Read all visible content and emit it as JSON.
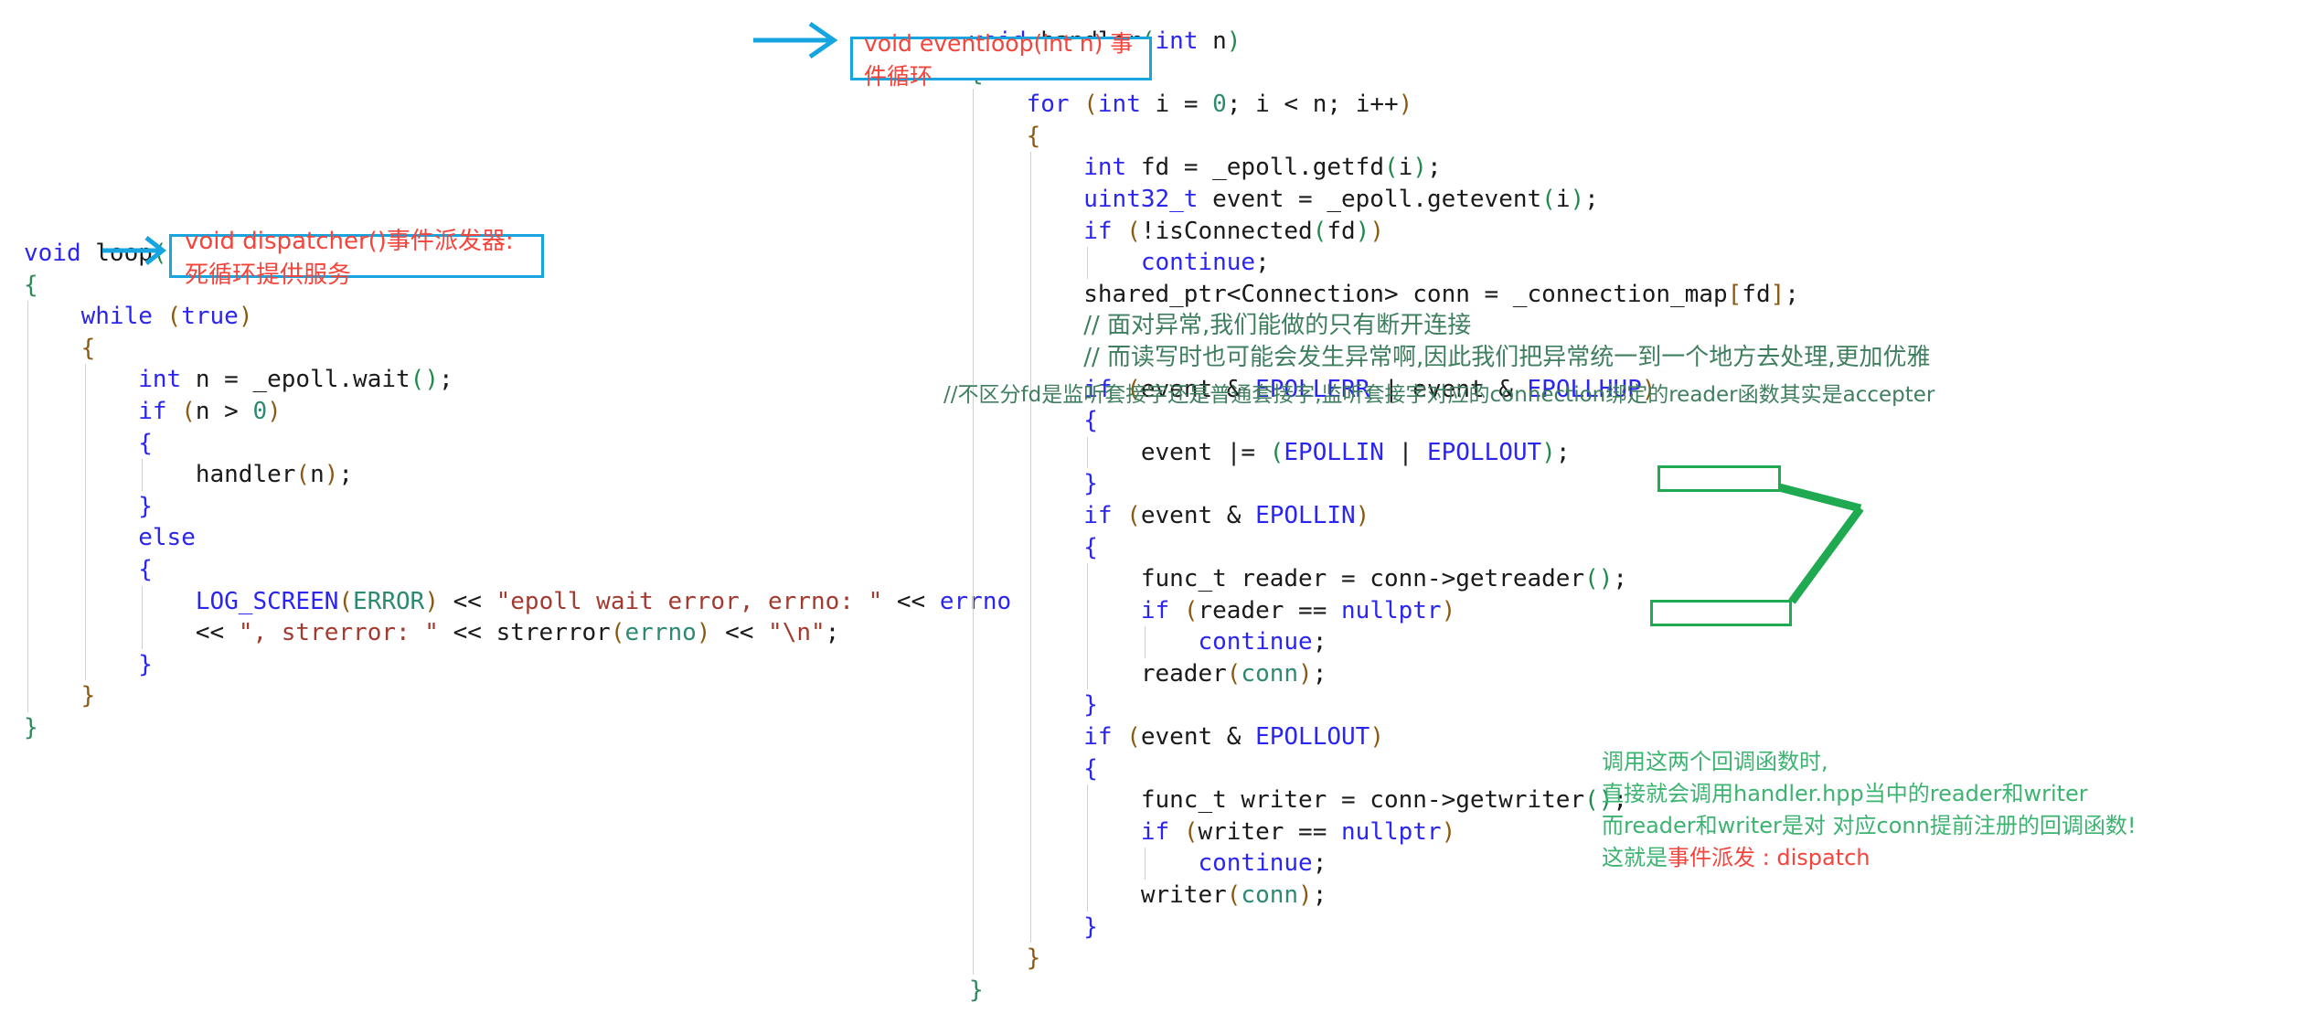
{
  "left_code": {
    "title": "void loop()",
    "lines": [
      [
        {
          "t": "void ",
          "c": "typ"
        },
        {
          "t": "loop",
          "c": "fn"
        },
        {
          "t": "()",
          "c": "par3"
        }
      ],
      [
        {
          "t": "{",
          "c": "brc-g"
        }
      ],
      [
        {
          "t": "    "
        },
        {
          "t": "while ",
          "c": "kw"
        },
        {
          "t": "(",
          "c": "par"
        },
        {
          "t": "true",
          "c": "kw"
        },
        {
          "t": ")",
          "c": "par"
        }
      ],
      [
        {
          "t": "    "
        },
        {
          "t": "{",
          "c": "brc-o"
        }
      ],
      [
        {
          "t": "        "
        },
        {
          "t": "int ",
          "c": "typ"
        },
        {
          "t": "n = _epoll.",
          "c": "pl"
        },
        {
          "t": "wait",
          "c": "fn"
        },
        {
          "t": "()",
          "c": "par3"
        },
        {
          "t": ";",
          "c": "pl"
        }
      ],
      [
        {
          "t": "        "
        },
        {
          "t": "if ",
          "c": "kw"
        },
        {
          "t": "(",
          "c": "par"
        },
        {
          "t": "n ",
          "c": "pl"
        },
        {
          "t": "> ",
          "c": "pl"
        },
        {
          "t": "0",
          "c": "num"
        },
        {
          "t": ")",
          "c": "par"
        }
      ],
      [
        {
          "t": "        "
        },
        {
          "t": "{",
          "c": "brc-b"
        }
      ],
      [
        {
          "t": "            "
        },
        {
          "t": "handler",
          "c": "pl"
        },
        {
          "t": "(",
          "c": "par"
        },
        {
          "t": "n",
          "c": "pl"
        },
        {
          "t": ")",
          "c": "par"
        },
        {
          "t": ";",
          "c": "pl"
        }
      ],
      [
        {
          "t": "        "
        },
        {
          "t": "}",
          "c": "brc-b"
        }
      ],
      [
        {
          "t": "        "
        },
        {
          "t": "else",
          "c": "kw"
        }
      ],
      [
        {
          "t": "        "
        },
        {
          "t": "{",
          "c": "brc-b"
        }
      ],
      [
        {
          "t": "            "
        },
        {
          "t": "LOG_SCREEN",
          "c": "mac"
        },
        {
          "t": "(",
          "c": "par"
        },
        {
          "t": "ERROR",
          "c": "id"
        },
        {
          "t": ")",
          "c": "par"
        },
        {
          "t": " << ",
          "c": "pl"
        },
        {
          "t": "\"epoll wait error, errno: \"",
          "c": "str"
        },
        {
          "t": " << ",
          "c": "pl"
        },
        {
          "t": "errno",
          "c": "mac"
        }
      ],
      [
        {
          "t": "            "
        },
        {
          "t": "<< ",
          "c": "pl"
        },
        {
          "t": "\", strerror: \"",
          "c": "str"
        },
        {
          "t": " << ",
          "c": "pl"
        },
        {
          "t": "strerror",
          "c": "pl"
        },
        {
          "t": "(",
          "c": "par"
        },
        {
          "t": "errno",
          "c": "id"
        },
        {
          "t": ")",
          "c": "par"
        },
        {
          "t": " << ",
          "c": "pl"
        },
        {
          "t": "\"\\n\"",
          "c": "str"
        },
        {
          "t": ";",
          "c": "pl"
        }
      ],
      [
        {
          "t": "        "
        },
        {
          "t": "}",
          "c": "brc-b"
        }
      ],
      [
        {
          "t": "    "
        },
        {
          "t": "}",
          "c": "brc-o"
        }
      ],
      [
        {
          "t": "}",
          "c": "brc-g"
        }
      ]
    ]
  },
  "right_code": {
    "title": "void handler(int n)",
    "lines": [
      [
        {
          "t": "void ",
          "c": "typ"
        },
        {
          "t": "handler",
          "c": "fn"
        },
        {
          "t": "(",
          "c": "par3"
        },
        {
          "t": "int ",
          "c": "typ"
        },
        {
          "t": "n",
          "c": "pl"
        },
        {
          "t": ")",
          "c": "par3"
        }
      ],
      [
        {
          "t": "{",
          "c": "brc-g"
        }
      ],
      [
        {
          "t": "    "
        },
        {
          "t": "for ",
          "c": "kw"
        },
        {
          "t": "(",
          "c": "par"
        },
        {
          "t": "int ",
          "c": "typ"
        },
        {
          "t": "i = ",
          "c": "pl"
        },
        {
          "t": "0",
          "c": "num"
        },
        {
          "t": "; i < n; i++",
          "c": "pl"
        },
        {
          "t": ")",
          "c": "par"
        }
      ],
      [
        {
          "t": "    "
        },
        {
          "t": "{",
          "c": "brc-o"
        }
      ],
      [
        {
          "t": "        "
        },
        {
          "t": "int ",
          "c": "typ"
        },
        {
          "t": "fd = _epoll.",
          "c": "pl"
        },
        {
          "t": "getfd",
          "c": "fn"
        },
        {
          "t": "(",
          "c": "par3"
        },
        {
          "t": "i",
          "c": "pl"
        },
        {
          "t": ")",
          "c": "par3"
        },
        {
          "t": ";",
          "c": "pl"
        }
      ],
      [
        {
          "t": "        "
        },
        {
          "t": "uint32_t ",
          "c": "typ"
        },
        {
          "t": "event = _epoll.",
          "c": "pl"
        },
        {
          "t": "getevent",
          "c": "fn"
        },
        {
          "t": "(",
          "c": "par3"
        },
        {
          "t": "i",
          "c": "pl"
        },
        {
          "t": ")",
          "c": "par3"
        },
        {
          "t": ";",
          "c": "pl"
        }
      ],
      [
        {
          "t": "        "
        },
        {
          "t": "if ",
          "c": "kw"
        },
        {
          "t": "(",
          "c": "par"
        },
        {
          "t": "!isConnected",
          "c": "pl"
        },
        {
          "t": "(",
          "c": "par3"
        },
        {
          "t": "fd",
          "c": "pl"
        },
        {
          "t": ")",
          "c": "par3"
        },
        {
          "t": ")",
          "c": "par"
        }
      ],
      [
        {
          "t": "            "
        },
        {
          "t": "continue",
          "c": "kw"
        },
        {
          "t": ";",
          "c": "pl"
        }
      ],
      [
        {
          "t": "        "
        },
        {
          "t": "shared_ptr<Connection> conn = _connection_map",
          "c": "pl"
        },
        {
          "t": "[",
          "c": "par"
        },
        {
          "t": "fd",
          "c": "pl"
        },
        {
          "t": "]",
          "c": "par"
        },
        {
          "t": ";",
          "c": "pl"
        }
      ],
      [
        {
          "t": "        "
        },
        {
          "t": "// 面对异常,我们能做的只有断开连接",
          "c": "cmt"
        }
      ],
      [
        {
          "t": "        "
        },
        {
          "t": "// 而读写时也可能会发生异常啊,因此我们把异常统一到一个地方去处理,更加优雅",
          "c": "cmt"
        }
      ],
      [
        {
          "t": "        "
        },
        {
          "t": "if ",
          "c": "kw"
        },
        {
          "t": "(",
          "c": "par"
        },
        {
          "t": "event & ",
          "c": "pl"
        },
        {
          "t": "EPOLLERR",
          "c": "mac"
        },
        {
          "t": " | ",
          "c": "pl"
        },
        {
          "t": "event & ",
          "c": "pl"
        },
        {
          "t": "EPOLLHUP",
          "c": "mac"
        },
        {
          "t": ")",
          "c": "par"
        }
      ],
      [
        {
          "t": "        "
        },
        {
          "t": "{",
          "c": "brc-b"
        }
      ],
      [
        {
          "t": "            "
        },
        {
          "t": "event |= ",
          "c": "pl"
        },
        {
          "t": "(",
          "c": "par3"
        },
        {
          "t": "EPOLLIN",
          "c": "mac"
        },
        {
          "t": " | ",
          "c": "pl"
        },
        {
          "t": "EPOLLOUT",
          "c": "mac"
        },
        {
          "t": ")",
          "c": "par3"
        },
        {
          "t": ";",
          "c": "pl"
        }
      ],
      [
        {
          "t": "        "
        },
        {
          "t": "}",
          "c": "brc-b"
        }
      ],
      [
        {
          "t": "        "
        },
        {
          "t": "if ",
          "c": "kw"
        },
        {
          "t": "(",
          "c": "par"
        },
        {
          "t": "event & ",
          "c": "pl"
        },
        {
          "t": "EPOLLIN",
          "c": "mac"
        },
        {
          "t": ")",
          "c": "par"
        }
      ],
      [
        {
          "t": "        "
        },
        {
          "t": "{",
          "c": "brc-b"
        }
      ],
      [
        {
          "t": "            "
        },
        {
          "t": "func_t reader = conn->",
          "c": "pl"
        },
        {
          "t": "getreader",
          "c": "fn"
        },
        {
          "t": "(",
          "c": "par3"
        },
        {
          "t": ")",
          "c": "par3"
        },
        {
          "t": ";",
          "c": "pl"
        }
      ],
      [
        {
          "t": "            "
        },
        {
          "t": "if ",
          "c": "kw"
        },
        {
          "t": "(",
          "c": "par"
        },
        {
          "t": "reader == ",
          "c": "pl"
        },
        {
          "t": "nullptr",
          "c": "kw"
        },
        {
          "t": ")",
          "c": "par"
        }
      ],
      [
        {
          "t": "                "
        },
        {
          "t": "continue",
          "c": "kw"
        },
        {
          "t": ";",
          "c": "pl"
        }
      ],
      [
        {
          "t": "            "
        },
        {
          "t": "reader",
          "c": "pl"
        },
        {
          "t": "(",
          "c": "par"
        },
        {
          "t": "conn",
          "c": "id"
        },
        {
          "t": ")",
          "c": "par"
        },
        {
          "t": ";",
          "c": "pl"
        }
      ],
      [
        {
          "t": "        "
        },
        {
          "t": "}",
          "c": "brc-b"
        }
      ],
      [
        {
          "t": "        "
        },
        {
          "t": "if ",
          "c": "kw"
        },
        {
          "t": "(",
          "c": "par"
        },
        {
          "t": "event & ",
          "c": "pl"
        },
        {
          "t": "EPOLLOUT",
          "c": "mac"
        },
        {
          "t": ")",
          "c": "par"
        }
      ],
      [
        {
          "t": "        "
        },
        {
          "t": "{",
          "c": "brc-b"
        }
      ],
      [
        {
          "t": "            "
        },
        {
          "t": "func_t writer = conn->",
          "c": "pl"
        },
        {
          "t": "getwriter",
          "c": "fn"
        },
        {
          "t": "(",
          "c": "par3"
        },
        {
          "t": ")",
          "c": "par3"
        },
        {
          "t": ";",
          "c": "pl"
        }
      ],
      [
        {
          "t": "            "
        },
        {
          "t": "if ",
          "c": "kw"
        },
        {
          "t": "(",
          "c": "par"
        },
        {
          "t": "writer == ",
          "c": "pl"
        },
        {
          "t": "nullptr",
          "c": "kw"
        },
        {
          "t": ")",
          "c": "par"
        }
      ],
      [
        {
          "t": "                "
        },
        {
          "t": "continue",
          "c": "kw"
        },
        {
          "t": ";",
          "c": "pl"
        }
      ],
      [
        {
          "t": "            "
        },
        {
          "t": "writer",
          "c": "pl"
        },
        {
          "t": "(",
          "c": "par"
        },
        {
          "t": "conn",
          "c": "id"
        },
        {
          "t": ")",
          "c": "par"
        },
        {
          "t": ";",
          "c": "pl"
        }
      ],
      [
        {
          "t": "        "
        },
        {
          "t": "}",
          "c": "brc-b"
        }
      ],
      [
        {
          "t": "    "
        },
        {
          "t": "}",
          "c": "brc-o"
        }
      ],
      [
        {
          "t": "}",
          "c": "brc-g"
        }
      ]
    ]
  },
  "floating_comment": "//不区分fd是监听套接字还是普通套接字,监听套接字对应的connection绑定的reader函数其实是accepter",
  "annotations": {
    "dispatcher": "void dispatcher()事件派发器: 死循环提供服务",
    "eventloop": "void eventloop(int n) 事件循环",
    "green": {
      "line1": "调用这两个回调函数时,",
      "line2": "直接就会调用handler.hpp当中的reader和writer",
      "line3_a": "而reader和writer是对 对应conn提前注册的回调函数!",
      "line4_a": "这就是",
      "line4_b": "事件派发 : dispatch"
    }
  },
  "colors": {
    "anno_border": "#17a5e0",
    "anno_text": "#f4443c",
    "green": "#3cb371",
    "green_box": "#1faa52",
    "arrow": "#17a5e0"
  }
}
